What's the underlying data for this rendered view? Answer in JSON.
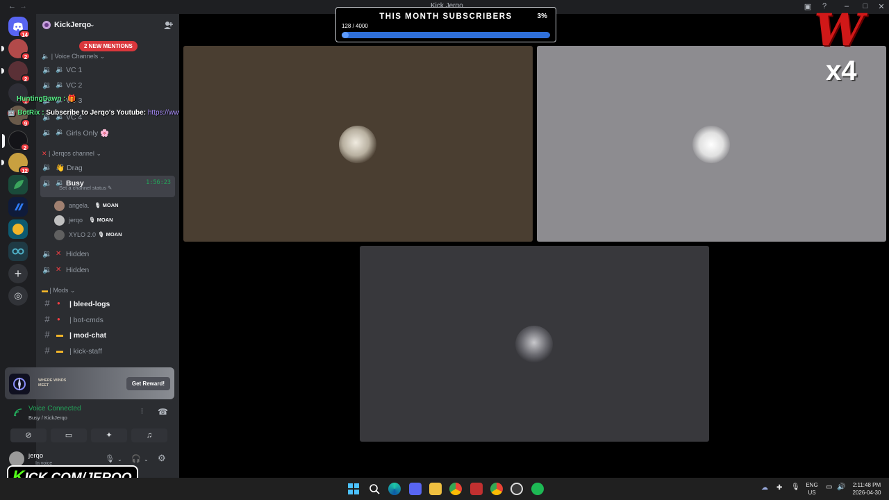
{
  "window": {
    "title": "Kick Jerqo",
    "back_icon": "arrow-left",
    "forward_icon": "arrow-right"
  },
  "rail": {
    "home_badge": "14",
    "servers": [
      {
        "name": "server-1",
        "badge": "2",
        "color": "#b24a4a"
      },
      {
        "name": "server-2",
        "badge": "2",
        "color": "#5a3036"
      },
      {
        "name": "server-3",
        "badge": "1",
        "color": "#2e2e36"
      },
      {
        "name": "server-4",
        "badge": "9",
        "color": "#6a5a4a"
      },
      {
        "name": "server-5",
        "badge": "2",
        "color": "#141418"
      },
      {
        "name": "server-6",
        "badge": "12",
        "color": "#c8a040"
      },
      {
        "name": "server-7",
        "badge": "",
        "color": "#3ba55d"
      },
      {
        "name": "server-8",
        "badge": "",
        "color": "#2553c9"
      },
      {
        "name": "server-9",
        "badge": "",
        "color": "#f0b429"
      },
      {
        "name": "server-10",
        "badge": "",
        "color": "#1f6f8b"
      }
    ]
  },
  "sidebar": {
    "guild_name": "KickJerqo",
    "mentions_pill": "2 NEW MENTIONS",
    "categories": {
      "voice": "Voice Channels",
      "jerqo": "Jerqos channel",
      "mods": "Mods"
    },
    "voice_channels": [
      "VC 1",
      "VC 2",
      "VC 3",
      "VC 4",
      "Girls Only 🌸"
    ],
    "jerqo_channels": {
      "drag": "👋 Drag",
      "busy": "Busy",
      "busy_timer": "1:56:23",
      "busy_status": "Set a channel status ✎",
      "hidden_1": "Hidden",
      "hidden_2": "Hidden"
    },
    "voice_users": [
      {
        "name": "angela.",
        "tag": "MOAN"
      },
      {
        "name": "jerqo",
        "tag": "MOAN"
      },
      {
        "name": "XYLO 2.0",
        "tag": "MOAN"
      }
    ],
    "mod_channels": [
      {
        "icon": "🩸",
        "name": "| bleed-logs",
        "bold": true
      },
      {
        "icon": "🩸",
        "name": "| bot-cmds",
        "bold": false
      },
      {
        "icon": "📁",
        "name": "| mod-chat",
        "bold": true
      },
      {
        "icon": "📁",
        "name": "| kick-staff",
        "bold": false
      }
    ]
  },
  "reward": {
    "game_text": "WHERE WINDS MEET",
    "button": "Get Reward!"
  },
  "voice_panel": {
    "status": "Voice Connected",
    "sub": "Busy / KickJerqo"
  },
  "userbar": {
    "username": "jerqo",
    "status": "In voice"
  },
  "chat_overlay": [
    {
      "user": "HuntingDawn :",
      "message": "🎁",
      "user_color": "#57f287"
    },
    {
      "user": "BotRix :",
      "message": "Subscribe to Jerqo's Youtube: ",
      "link": "https://www.youtube.com/jerqobeats",
      "user_color": "#57f287"
    }
  ],
  "goal": {
    "title": "THIS MONTH SUBSCRIBERS",
    "percent_label": "3%",
    "count": "128 / 4000",
    "progress": 0.032
  },
  "multiplier": {
    "letter": "W",
    "value": "x4"
  },
  "kick_overlay": {
    "k": "K",
    "text": "ICK.COM/JERQO"
  },
  "tiles": [
    {
      "name": "tile-1",
      "bg": "#4a3e31"
    },
    {
      "name": "tile-2",
      "bg": "#8d8c90"
    },
    {
      "name": "tile-3",
      "bg": "#38383c"
    }
  ],
  "tray": {
    "lang": "ENG",
    "region": "US",
    "time": "2:11:48 PM",
    "date": "2026-04-30"
  },
  "colors": {
    "discord_green": "#23a55a",
    "mention_red": "#da373c",
    "kick_green": "#53fc18"
  }
}
